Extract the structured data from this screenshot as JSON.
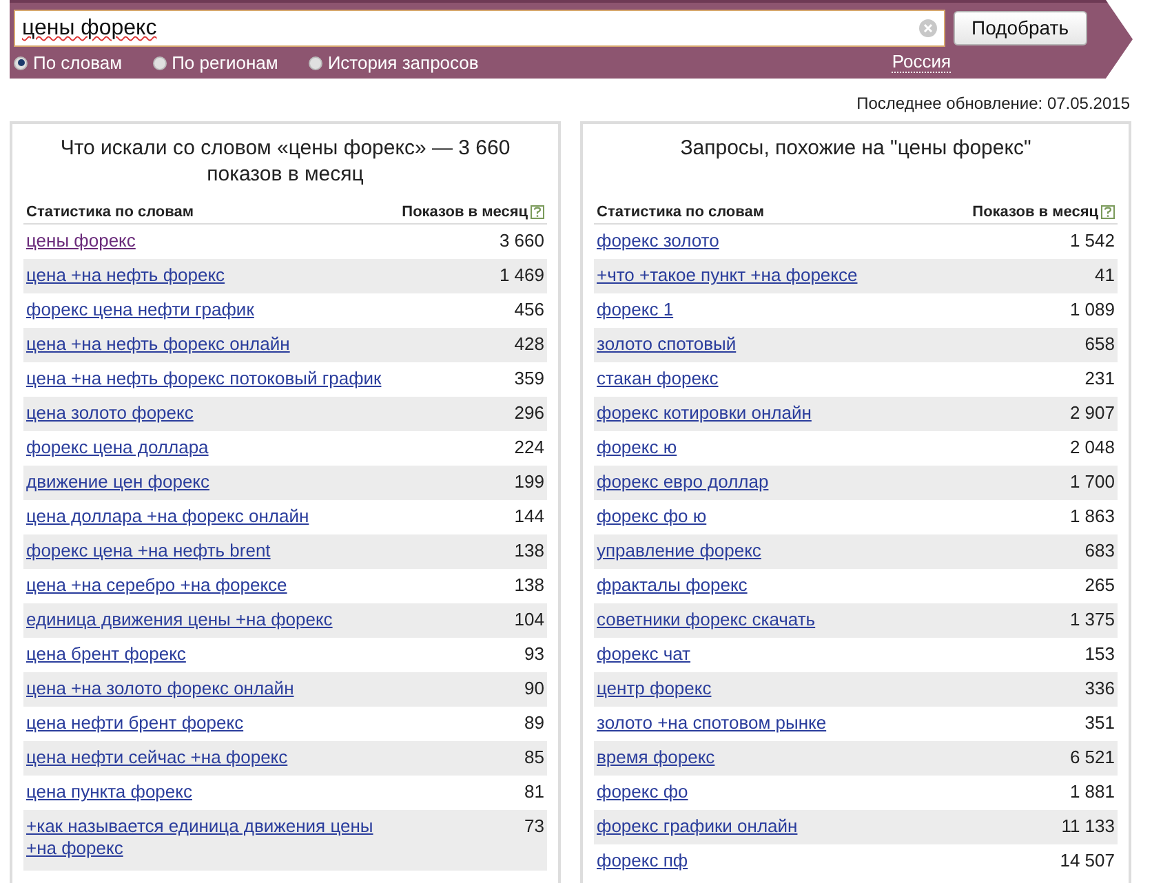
{
  "search": {
    "value": "цены форекс",
    "button": "Подобрать",
    "modes": [
      {
        "label": "По словам",
        "selected": true
      },
      {
        "label": "По регионам",
        "selected": false
      },
      {
        "label": "История запросов",
        "selected": false
      }
    ],
    "region": "Россия"
  },
  "last_update": "Последнее обновление: 07.05.2015",
  "panels": [
    {
      "title": "Что искали со словом «цены форекс» — 3 660 показов в месяц",
      "columns": [
        "Статистика по словам",
        "Показов в месяц"
      ],
      "rows": [
        {
          "phrase": "цены форекс",
          "count": "3 660",
          "visited": true
        },
        {
          "phrase": "цена +на нефть форекс",
          "count": "1 469",
          "visited": false
        },
        {
          "phrase": "форекс цена нефти график",
          "count": "456",
          "visited": false
        },
        {
          "phrase": "цена +на нефть форекс онлайн",
          "count": "428",
          "visited": false
        },
        {
          "phrase": "цена +на нефть форекс потоковый график",
          "count": "359",
          "visited": false
        },
        {
          "phrase": "цена золото форекс",
          "count": "296",
          "visited": false
        },
        {
          "phrase": "форекс цена доллара",
          "count": "224",
          "visited": false
        },
        {
          "phrase": "движение цен форекс",
          "count": "199",
          "visited": false
        },
        {
          "phrase": "цена доллара +на форекс онлайн",
          "count": "144",
          "visited": false
        },
        {
          "phrase": "форекс цена +на нефть brent",
          "count": "138",
          "visited": false
        },
        {
          "phrase": "цена +на серебро +на форексе",
          "count": "138",
          "visited": false
        },
        {
          "phrase": "единица движения цены +на форекс",
          "count": "104",
          "visited": false
        },
        {
          "phrase": "цена брент форекс",
          "count": "93",
          "visited": false
        },
        {
          "phrase": "цена +на золото форекс онлайн",
          "count": "90",
          "visited": false
        },
        {
          "phrase": "цена нефти брент форекс",
          "count": "89",
          "visited": false
        },
        {
          "phrase": "цена нефти сейчас +на форекс",
          "count": "85",
          "visited": false
        },
        {
          "phrase": "цена пункта форекс",
          "count": "81",
          "visited": false
        },
        {
          "phrase": "+как называется единица движения цены +на форекс",
          "count": "73",
          "visited": false
        }
      ]
    },
    {
      "title": "Запросы, похожие на \"цены форекс\"",
      "columns": [
        "Статистика по словам",
        "Показов в месяц"
      ],
      "rows": [
        {
          "phrase": "форекс золото",
          "count": "1 542",
          "visited": false
        },
        {
          "phrase": "+что +такое пункт +на форексе",
          "count": "41",
          "visited": false
        },
        {
          "phrase": "форекс 1",
          "count": "1 089",
          "visited": false
        },
        {
          "phrase": "золото спотовый",
          "count": "658",
          "visited": false
        },
        {
          "phrase": "стакан форекс",
          "count": "231",
          "visited": false
        },
        {
          "phrase": "форекс котировки онлайн",
          "count": "2 907",
          "visited": false
        },
        {
          "phrase": "форекс ю",
          "count": "2 048",
          "visited": false
        },
        {
          "phrase": "форекс евро доллар",
          "count": "1 700",
          "visited": false
        },
        {
          "phrase": "форекс фо ю",
          "count": "1 863",
          "visited": false
        },
        {
          "phrase": "управление форекс",
          "count": "683",
          "visited": false
        },
        {
          "phrase": "фракталы форекс",
          "count": "265",
          "visited": false
        },
        {
          "phrase": "советники форекс скачать",
          "count": "1 375",
          "visited": false
        },
        {
          "phrase": "форекс чат",
          "count": "153",
          "visited": false
        },
        {
          "phrase": "центр форекс",
          "count": "336",
          "visited": false
        },
        {
          "phrase": "золото +на спотовом рынке",
          "count": "351",
          "visited": false
        },
        {
          "phrase": "время форекс",
          "count": "6 521",
          "visited": false
        },
        {
          "phrase": "форекс фо",
          "count": "1 881",
          "visited": false
        },
        {
          "phrase": "форекс графики онлайн",
          "count": "11 133",
          "visited": false
        },
        {
          "phrase": "форекс пф",
          "count": "14 507",
          "visited": false
        }
      ]
    }
  ]
}
